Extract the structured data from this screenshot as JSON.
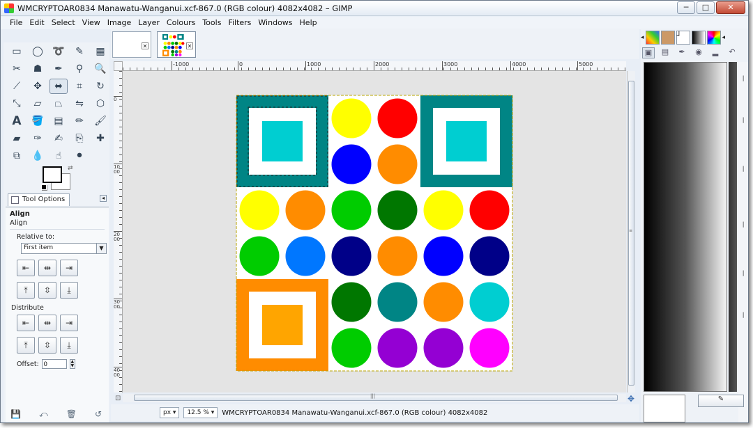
{
  "window": {
    "title": "WMCRYPTOAR0834 Manawatu-Wanganui.xcf-867.0 (RGB colour) 4082x4082 – GIMP",
    "minimize": "─",
    "maximize": "□",
    "close": "✕"
  },
  "menu": [
    "File",
    "Edit",
    "Select",
    "View",
    "Image",
    "Layer",
    "Colours",
    "Tools",
    "Filters",
    "Windows",
    "Help"
  ],
  "tool_options": {
    "tab_label": "Tool Options",
    "title": "Align",
    "subtitle": "Align",
    "relative_to_label": "Relative to:",
    "relative_to_value": "First item",
    "distribute_label": "Distribute",
    "offset_label": "Offset:",
    "offset_value": "0"
  },
  "ruler": {
    "h_labels": [
      "-1000",
      "0",
      "1000",
      "2000",
      "3000",
      "4000",
      "5000"
    ],
    "v_labels": [
      "0",
      "1000",
      "2000",
      "3000",
      "4000"
    ]
  },
  "status": {
    "unit": "px",
    "zoom": "12.5 %",
    "text": "WMCRYPTOAR0834 Manawatu-Wanganui.xcf-867.0 (RGB colour) 4082x4082"
  },
  "colors": {
    "teal": "#008585",
    "cyan": "#00ced1",
    "orange": "#ff8c00",
    "light_orange": "#ffa500",
    "yellow": "#ffff00",
    "red": "#ff0000",
    "blue": "#0000ff",
    "green": "#00cc00",
    "dark_green": "#007700",
    "sky_blue": "#0077ff",
    "navy": "#000088",
    "purple": "#9400d3",
    "magenta": "#ff00ff"
  },
  "canvas": {
    "circles": [
      {
        "color": "yellow"
      },
      {
        "color": "red"
      },
      {
        "color": "blue"
      },
      {
        "color": "orange"
      },
      {
        "color": "yellow"
      },
      {
        "color": "orange"
      },
      {
        "color": "green"
      },
      {
        "color": "dark_green"
      },
      {
        "color": "yellow"
      },
      {
        "color": "red"
      },
      {
        "color": "green"
      },
      {
        "color": "sky_blue"
      },
      {
        "color": "navy"
      },
      {
        "color": "orange"
      },
      {
        "color": "blue"
      },
      {
        "color": "navy"
      },
      {
        "color": "dark_green"
      },
      {
        "color": "teal"
      },
      {
        "color": "orange"
      },
      {
        "color": "cyan"
      },
      {
        "color": "green"
      },
      {
        "color": "purple"
      },
      {
        "color": "purple"
      },
      {
        "color": "magenta"
      }
    ],
    "squares": [
      {
        "outer": "teal",
        "inner": "cyan"
      },
      {
        "outer": "teal",
        "inner": "cyan"
      },
      {
        "outer": "orange",
        "inner": "light_orange"
      }
    ]
  }
}
